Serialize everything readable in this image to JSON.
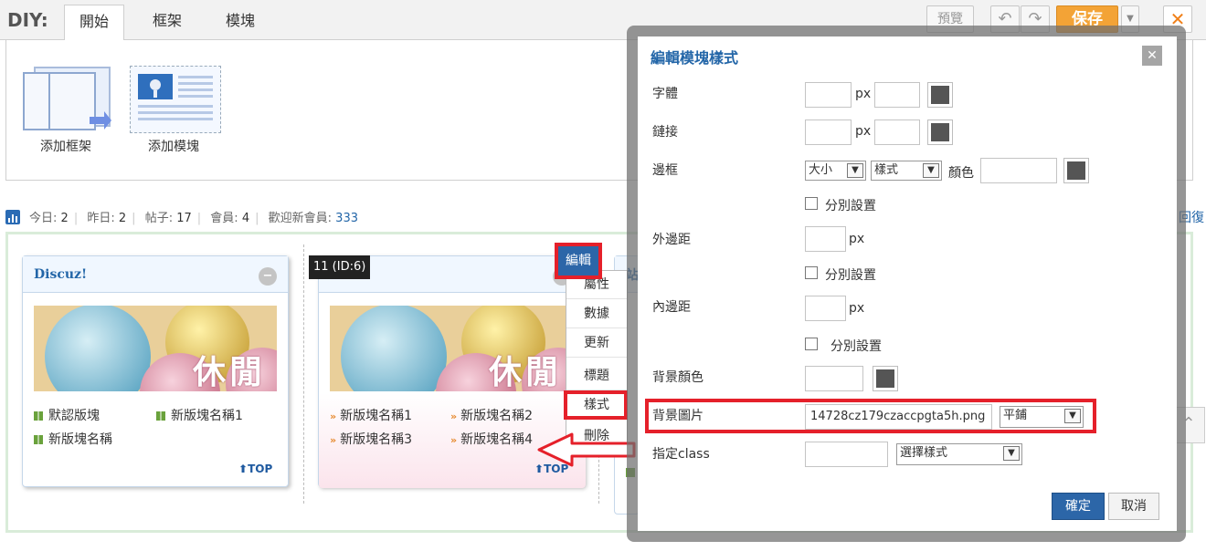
{
  "topbar": {
    "diy_label": "DIY:",
    "tabs": [
      {
        "label": "開始"
      },
      {
        "label": "框架"
      },
      {
        "label": "模塊"
      }
    ],
    "preview_label": "預覽",
    "undo_icon": "undo-icon",
    "redo_icon": "redo-icon",
    "save_label": "保存",
    "close_icon": "close-icon"
  },
  "add_panel": {
    "add_frame_label": "添加框架",
    "add_module_label": "添加模塊"
  },
  "stats": {
    "today_label": "今日:",
    "today": "2",
    "yesterday_label": "昨日:",
    "yesterday": "2",
    "posts_label": "帖子:",
    "posts": "17",
    "members_label": "會員:",
    "members": "4",
    "welcome_label": "歡迎新會員:",
    "welcome_user": "333",
    "right_text": "回復"
  },
  "cards": [
    {
      "title": "Discuz!",
      "banner_text": "休閒",
      "items": [
        "默認版塊",
        "新版塊名稱1",
        "新版塊名稱"
      ],
      "top_label": "TOP"
    },
    {
      "block_label": "11 (ID:6)",
      "banner_text": "休閒",
      "items": [
        "新版塊名稱1",
        "新版塊名稱2",
        "新版塊名稱3",
        "新版塊名稱4"
      ],
      "top_label": "TOP"
    }
  ],
  "card3_title": "站",
  "context_menu": {
    "edit_label": "編輯",
    "items": [
      "屬性",
      "數據",
      "更新",
      "標題",
      "樣式",
      "刪除"
    ]
  },
  "modal": {
    "title": "編輯模塊樣式",
    "font_label": "字體",
    "link_label": "鏈接",
    "border_label": "邊框",
    "border_size_select": "大小",
    "border_style_select": "樣式",
    "border_color_label": "顏色",
    "separate_label": "分別設置",
    "margin_label": "外邊距",
    "padding_label": "內邊距",
    "bg_color_label": "背景顏色",
    "bg_image_label": "背景圖片",
    "bg_image_value": "14728cz179czaccpgta5h.png",
    "bg_repeat_select": "平鋪",
    "class_label": "指定class",
    "class_select": "選擇樣式",
    "unit_px": "px",
    "ok_label": "確定",
    "cancel_label": "取消"
  },
  "colors": {
    "accent_blue": "#2c66a8",
    "save_orange": "#f3a336",
    "highlight_red": "#e5202a"
  }
}
